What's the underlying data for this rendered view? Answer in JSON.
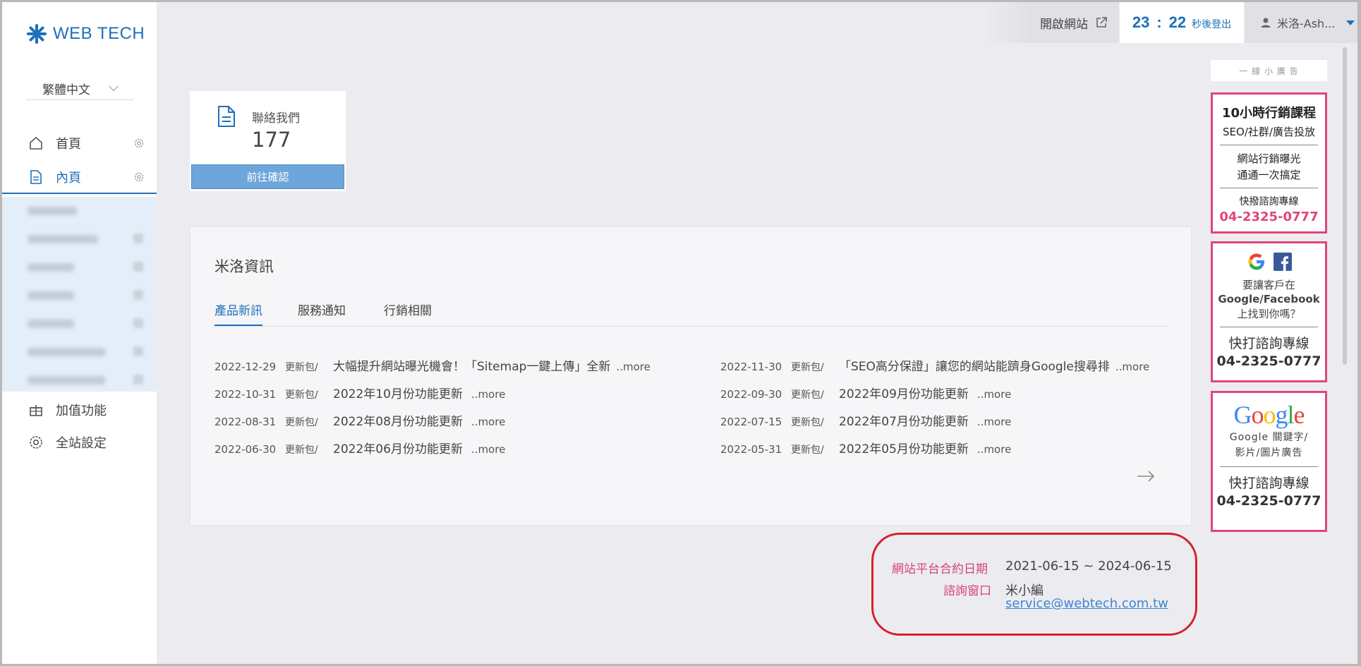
{
  "brand": {
    "name": "WEB TECH",
    "accent": "#1d6fb8"
  },
  "sidebar": {
    "language": "繁體中文",
    "items": [
      {
        "label": "首頁"
      },
      {
        "label": "內頁"
      },
      {
        "label": "加值功能"
      },
      {
        "label": "全站設定"
      }
    ]
  },
  "topbar": {
    "open_site": "開啟網站",
    "timer": {
      "minutes": "23",
      "separator": ":",
      "seconds": "22",
      "suffix": "秒後登出"
    },
    "user": "米洛-Ash..."
  },
  "contact_card": {
    "title": "聯絡我們",
    "count": "177",
    "button": "前往確認"
  },
  "news": {
    "heading": "米洛資訊",
    "tabs": [
      "產品新訊",
      "服務通知",
      "行銷相關"
    ],
    "items": [
      {
        "date": "2022-12-29",
        "category": "更新包/",
        "title": "大幅提升網站曝光機會！「Sitemap一鍵上傳」全新",
        "more": "..more"
      },
      {
        "date": "2022-11-30",
        "category": "更新包/",
        "title": "「SEO高分保證」讓您的網站能躋身Google搜尋排",
        "more": "..more"
      },
      {
        "date": "2022-10-31",
        "category": "更新包/",
        "title": "2022年10月份功能更新",
        "more": "..more"
      },
      {
        "date": "2022-09-30",
        "category": "更新包/",
        "title": "2022年09月份功能更新",
        "more": "..more"
      },
      {
        "date": "2022-08-31",
        "category": "更新包/",
        "title": "2022年08月份功能更新",
        "more": "..more"
      },
      {
        "date": "2022-07-15",
        "category": "更新包/",
        "title": "2022年07月份功能更新",
        "more": "..more"
      },
      {
        "date": "2022-06-30",
        "category": "更新包/",
        "title": "2022年06月份功能更新",
        "more": "..more"
      },
      {
        "date": "2022-05-31",
        "category": "更新包/",
        "title": "2022年05月份功能更新",
        "more": "..more"
      }
    ]
  },
  "contract": {
    "date_label": "網站平台合約日期",
    "date_value": "2021-06-15 ~ 2024-06-15",
    "contact_label": "諮詢窗口",
    "contact_name": "米小編",
    "contact_email": "service@webtech.com.tw"
  },
  "ads": {
    "header": "一 線 小 廣 告",
    "ad1": {
      "title": "10小時行銷課程",
      "subtitle": "SEO/社群/廣告投放",
      "line1": "網站行銷曝光",
      "line2": "通通一次搞定",
      "hotline_label": "快撥諮詢專線",
      "phone": "04-2325-0777"
    },
    "ad2": {
      "line1": "要讓客戶在",
      "line2": "Google/Facebook",
      "line3": "上找到你嗎？",
      "hotline_label": "快打諮詢專線",
      "phone": "04-2325-0777"
    },
    "ad3": {
      "logo": "Google",
      "line1": "Google 關鍵字/",
      "line2": "影片/圖片廣告",
      "hotline_label": "快打諮詢專線",
      "phone": "04-2325-0777"
    }
  }
}
